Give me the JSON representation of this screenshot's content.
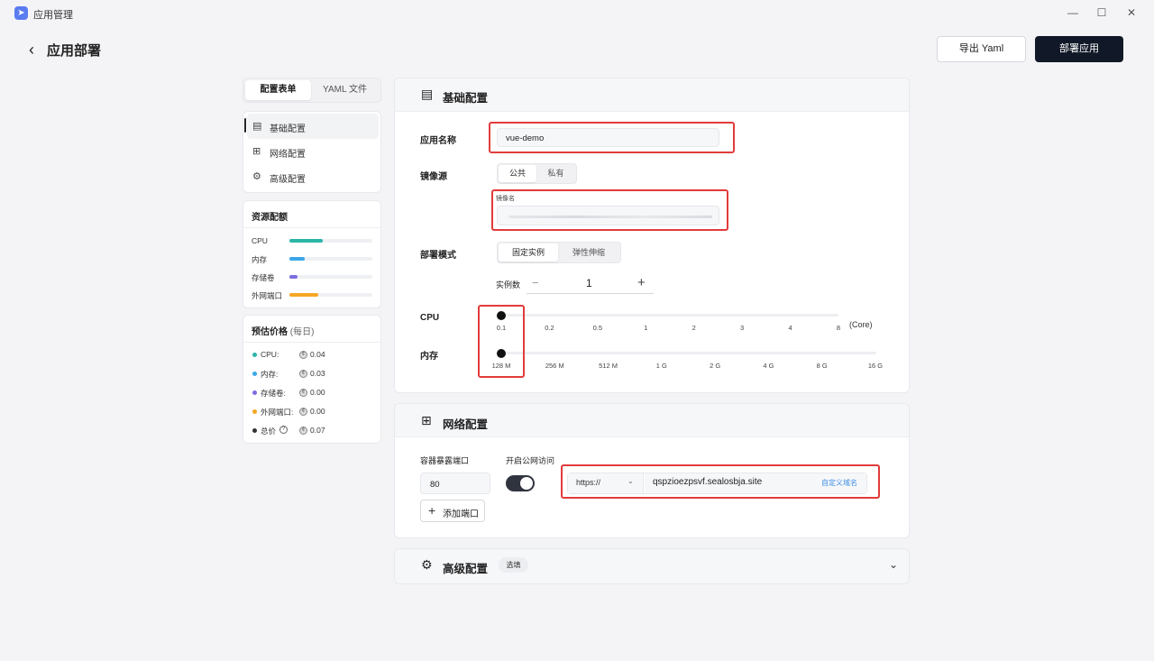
{
  "window": {
    "title": "应用管理",
    "app_icon": "rocket-icon",
    "minimize": "—",
    "maximize": "☐",
    "close": "✕"
  },
  "header": {
    "back_icon": "chevron-left-icon",
    "title": "应用部署",
    "export_label": "导出 Yaml",
    "deploy_label": "部署应用"
  },
  "tabs": {
    "form": "配置表单",
    "yaml": "YAML 文件"
  },
  "nav": [
    {
      "label": "基础配置",
      "icon": "document-icon"
    },
    {
      "label": "网络配置",
      "icon": "network-icon"
    },
    {
      "label": "高级配置",
      "icon": "gear-icon"
    }
  ],
  "resources": {
    "title": "资源配额",
    "items": [
      {
        "label": "CPU",
        "color": "#2bb6a8",
        "fraction": 0.4
      },
      {
        "label": "内存",
        "color": "#3aa6e8",
        "fraction": 0.18
      },
      {
        "label": "存储卷",
        "color": "#7b6ee0",
        "fraction": 0.1
      },
      {
        "label": "外网端口",
        "color": "#f5a623",
        "fraction": 0.35
      }
    ]
  },
  "price": {
    "title": "预估价格",
    "title_suffix": "(每日)",
    "items": [
      {
        "label": "CPU:",
        "color": "#2bb6a8",
        "value": "0.04"
      },
      {
        "label": "内存:",
        "color": "#3aa6e8",
        "value": "0.03"
      },
      {
        "label": "存储卷:",
        "color": "#7b6ee0",
        "value": "0.00"
      },
      {
        "label": "外网端口:",
        "color": "#f5a623",
        "value": "0.00"
      },
      {
        "label": "总价",
        "color": "#333333",
        "value": "0.07"
      }
    ]
  },
  "basic": {
    "title": "基础配置",
    "app_name_label": "应用名称",
    "app_name_value": "vue-demo",
    "image_source_label": "镜像源",
    "image_public": "公共",
    "image_private": "私有",
    "image_name_label": "镜像名",
    "deploy_mode_label": "部署模式",
    "mode_fixed": "固定实例",
    "mode_elastic": "弹性伸缩",
    "replicas_label": "实例数",
    "replicas_minus": "−",
    "replicas_value": "1",
    "replicas_plus": "+",
    "cpu_label": "CPU",
    "cpu_ticks": [
      "0.1",
      "0.2",
      "0.5",
      "1",
      "2",
      "3",
      "4",
      "8"
    ],
    "cpu_unit": "(Core)",
    "cpu_selected_index": 0,
    "mem_label": "内存",
    "mem_ticks": [
      "128 M",
      "256 M",
      "512 M",
      "1 G",
      "2 G",
      "4 G",
      "8 G",
      "16 G"
    ],
    "mem_selected_index": 0
  },
  "network": {
    "title": "网络配置",
    "port_label": "容器暴露端口",
    "port_value": "80",
    "public_label": "开启公网访问",
    "public_enabled": true,
    "protocol": "https://",
    "domain": "qspzioezpsvf.sealosbja.site",
    "custom_domain": "自定义域名",
    "add_port": "添加端口"
  },
  "advanced": {
    "title": "高级配置",
    "badge": "选填"
  },
  "colors": {
    "accent": "#111827",
    "highlight": "#e23b3b",
    "link": "#3a8ee6"
  }
}
